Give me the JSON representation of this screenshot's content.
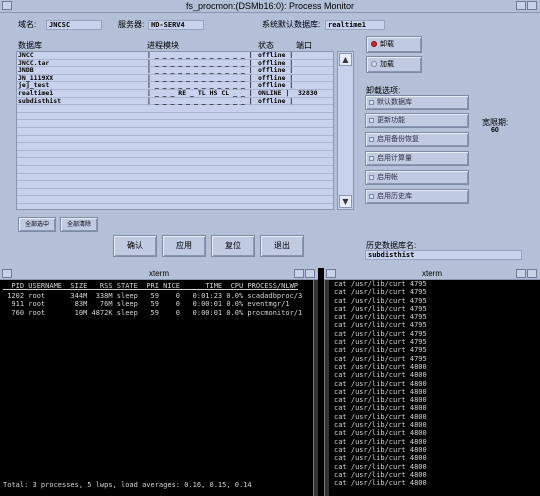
{
  "window": {
    "title": "fs_procmon:(DSMb16:0): Process Monitor"
  },
  "header": {
    "domain_label": "域名:",
    "domain_value": "JNCSC",
    "server_label": "服务器:",
    "server_value": "HD-SERV4",
    "db_label": "系统默认数据库:",
    "db_value": "realtime1"
  },
  "list": {
    "headers": [
      "数据库",
      "进程模块",
      "状态",
      "端口"
    ],
    "rows": [
      {
        "db": "JNCC",
        "modules": "| _ _ _ _ _ _ _ _ _ _ _ _ |",
        "status": "offline |",
        "port": ""
      },
      {
        "db": "JNCC.tar",
        "modules": "| _ _ _ _ _ _ _ _ _ _ _ _ |",
        "status": "offline |",
        "port": ""
      },
      {
        "db": "JNDB",
        "modules": "| _ _ _ _ _ _ _ _ _ _ _ _ |",
        "status": "offline |",
        "port": ""
      },
      {
        "db": "JN_1119XX",
        "modules": "| _ _ _ _ _ _ _ _ _ _ _ _ |",
        "status": "offline |",
        "port": ""
      },
      {
        "db": "jej_test",
        "modules": "| _ _ _ _ _ _ _ _ _ _ _ _ |",
        "status": "offline |",
        "port": ""
      },
      {
        "db": "realtime1",
        "modules": "| _ _ _ RE _ TL HS CL _ _ |",
        "status": "ONLINE  |",
        "port": "32830"
      },
      {
        "db": "subdisthist",
        "modules": "| _ _ _ _ _ _ _ _ _ _ _ _ |",
        "status": "offline |",
        "port": ""
      }
    ],
    "empty_rows": 13
  },
  "right_panel": {
    "unload_label": "卸载",
    "load_label": "加载",
    "options_title": "卸载选项:",
    "options": [
      "默认数据库",
      "更新功能",
      "启用备份恢复",
      "启用计算量",
      "启用帐",
      "启用历史库"
    ],
    "width_label": "宽限期:",
    "width_value": "60"
  },
  "buttons": {
    "select_all": "全部选中",
    "clear_all": "全部清除",
    "ok": "确认",
    "apply": "应用",
    "reset": "复位",
    "exit": "退出"
  },
  "history": {
    "label": "历史数据库名:",
    "value": "subdisthist"
  },
  "xterm_left": {
    "title": "xterm",
    "header": "  PID USERNAME  SIZE   RSS STATE  PRI NICE      TIME  CPU PROCESS/NLWP",
    "lines": [
      " 1202 root      344M  338M sleep   59    0   0:01:23 0.0% scadadbproc/3",
      "  911 root       83M   76M sleep   59    0   0:00:01 0.0% eventmgr/1",
      "  760 root       10M 4872K sleep   59    0   0:00:01 0.0% procmonitor/1"
    ],
    "footer": "Total: 3 processes, 5 lwps, load averages: 0.16, 0.15, 0.14"
  },
  "xterm_right": {
    "title": "xterm",
    "lines": [
      "cat /usr/lib/curt 4795",
      "cat /usr/lib/curt 4795",
      "cat /usr/lib/curt 4795",
      "cat /usr/lib/curt 4795",
      "cat /usr/lib/curt 4795",
      "cat /usr/lib/curt 4795",
      "cat /usr/lib/curt 4795",
      "cat /usr/lib/curt 4795",
      "cat /usr/lib/curt 4795",
      "cat /usr/lib/curt 4795",
      "cat /usr/lib/curt 4800",
      "cat /usr/lib/curt 4800",
      "cat /usr/lib/curt 4800",
      "cat /usr/lib/curt 4800",
      "cat /usr/lib/curt 4800",
      "cat /usr/lib/curt 4800",
      "cat /usr/lib/curt 4800",
      "cat /usr/lib/curt 4800",
      "cat /usr/lib/curt 4800",
      "cat /usr/lib/curt 4800",
      "cat /usr/lib/curt 4800",
      "cat /usr/lib/curt 4800",
      "cat /usr/lib/curt 4800",
      "cat /usr/lib/curt 4800",
      "cat /usr/lib/curt 4800"
    ]
  },
  "colors": {
    "radio_selected": "#e02020",
    "panel_bg": "#b4c0d8",
    "field_bg": "#c8d2ec"
  }
}
